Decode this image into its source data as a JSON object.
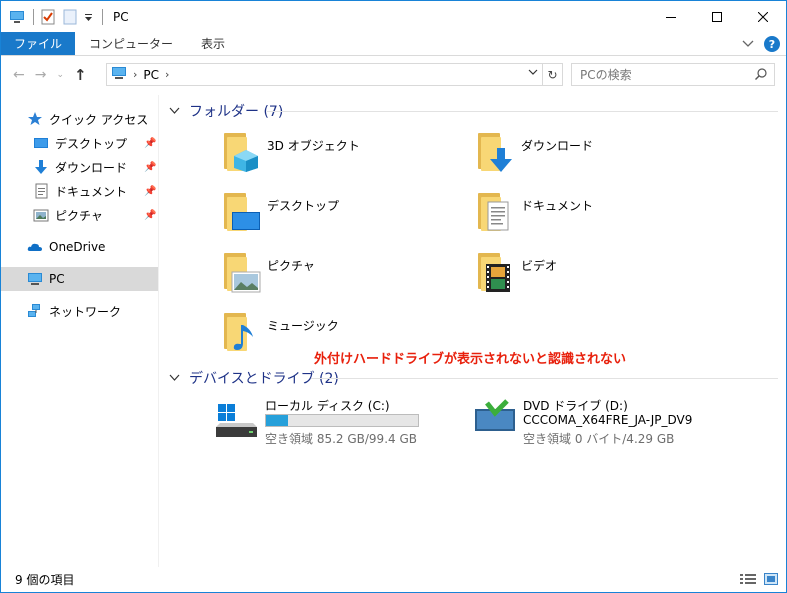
{
  "window": {
    "title": "PC"
  },
  "ribbon": {
    "tabs": [
      "ファイル",
      "コンピューター",
      "表示"
    ]
  },
  "address": {
    "path": "PC"
  },
  "search": {
    "placeholder": "PCの検索"
  },
  "nav": {
    "quick_access": "クイック アクセス",
    "quick_items": [
      "デスクトップ",
      "ダウンロード",
      "ドキュメント",
      "ピクチャ"
    ],
    "onedrive": "OneDrive",
    "pc": "PC",
    "network": "ネットワーク"
  },
  "folders_group": {
    "title": "フォルダー (7)"
  },
  "folders": [
    {
      "label": "3D オブジェクト",
      "icon": "3d-objects-folder-icon"
    },
    {
      "label": "ダウンロード",
      "icon": "downloads-folder-icon"
    },
    {
      "label": "デスクトップ",
      "icon": "desktop-folder-icon"
    },
    {
      "label": "ドキュメント",
      "icon": "documents-folder-icon"
    },
    {
      "label": "ピクチャ",
      "icon": "pictures-folder-icon"
    },
    {
      "label": "ビデオ",
      "icon": "videos-folder-icon"
    },
    {
      "label": "ミュージック",
      "icon": "music-folder-icon"
    }
  ],
  "annotation": "外付けハードドライブが表示されないと認識されない",
  "devices_group": {
    "title": "デバイスとドライブ (2)"
  },
  "drives": {
    "local": {
      "name": "ローカル ディスク (C:)",
      "free": "空き領域 85.2 GB/99.4 GB",
      "used_fraction": 0.143
    },
    "dvd": {
      "name": "DVD ドライブ (D:)",
      "volume": "CCCOMA_X64FRE_JA-JP_DV9",
      "free": "空き領域 0 バイト/4.29 GB"
    }
  },
  "status": {
    "items": "9 個の項目"
  },
  "colors": {
    "accent": "#1979ca",
    "annotation": "#e8200c",
    "group_header": "#1e3287",
    "bar_fill": "#26a0da"
  }
}
